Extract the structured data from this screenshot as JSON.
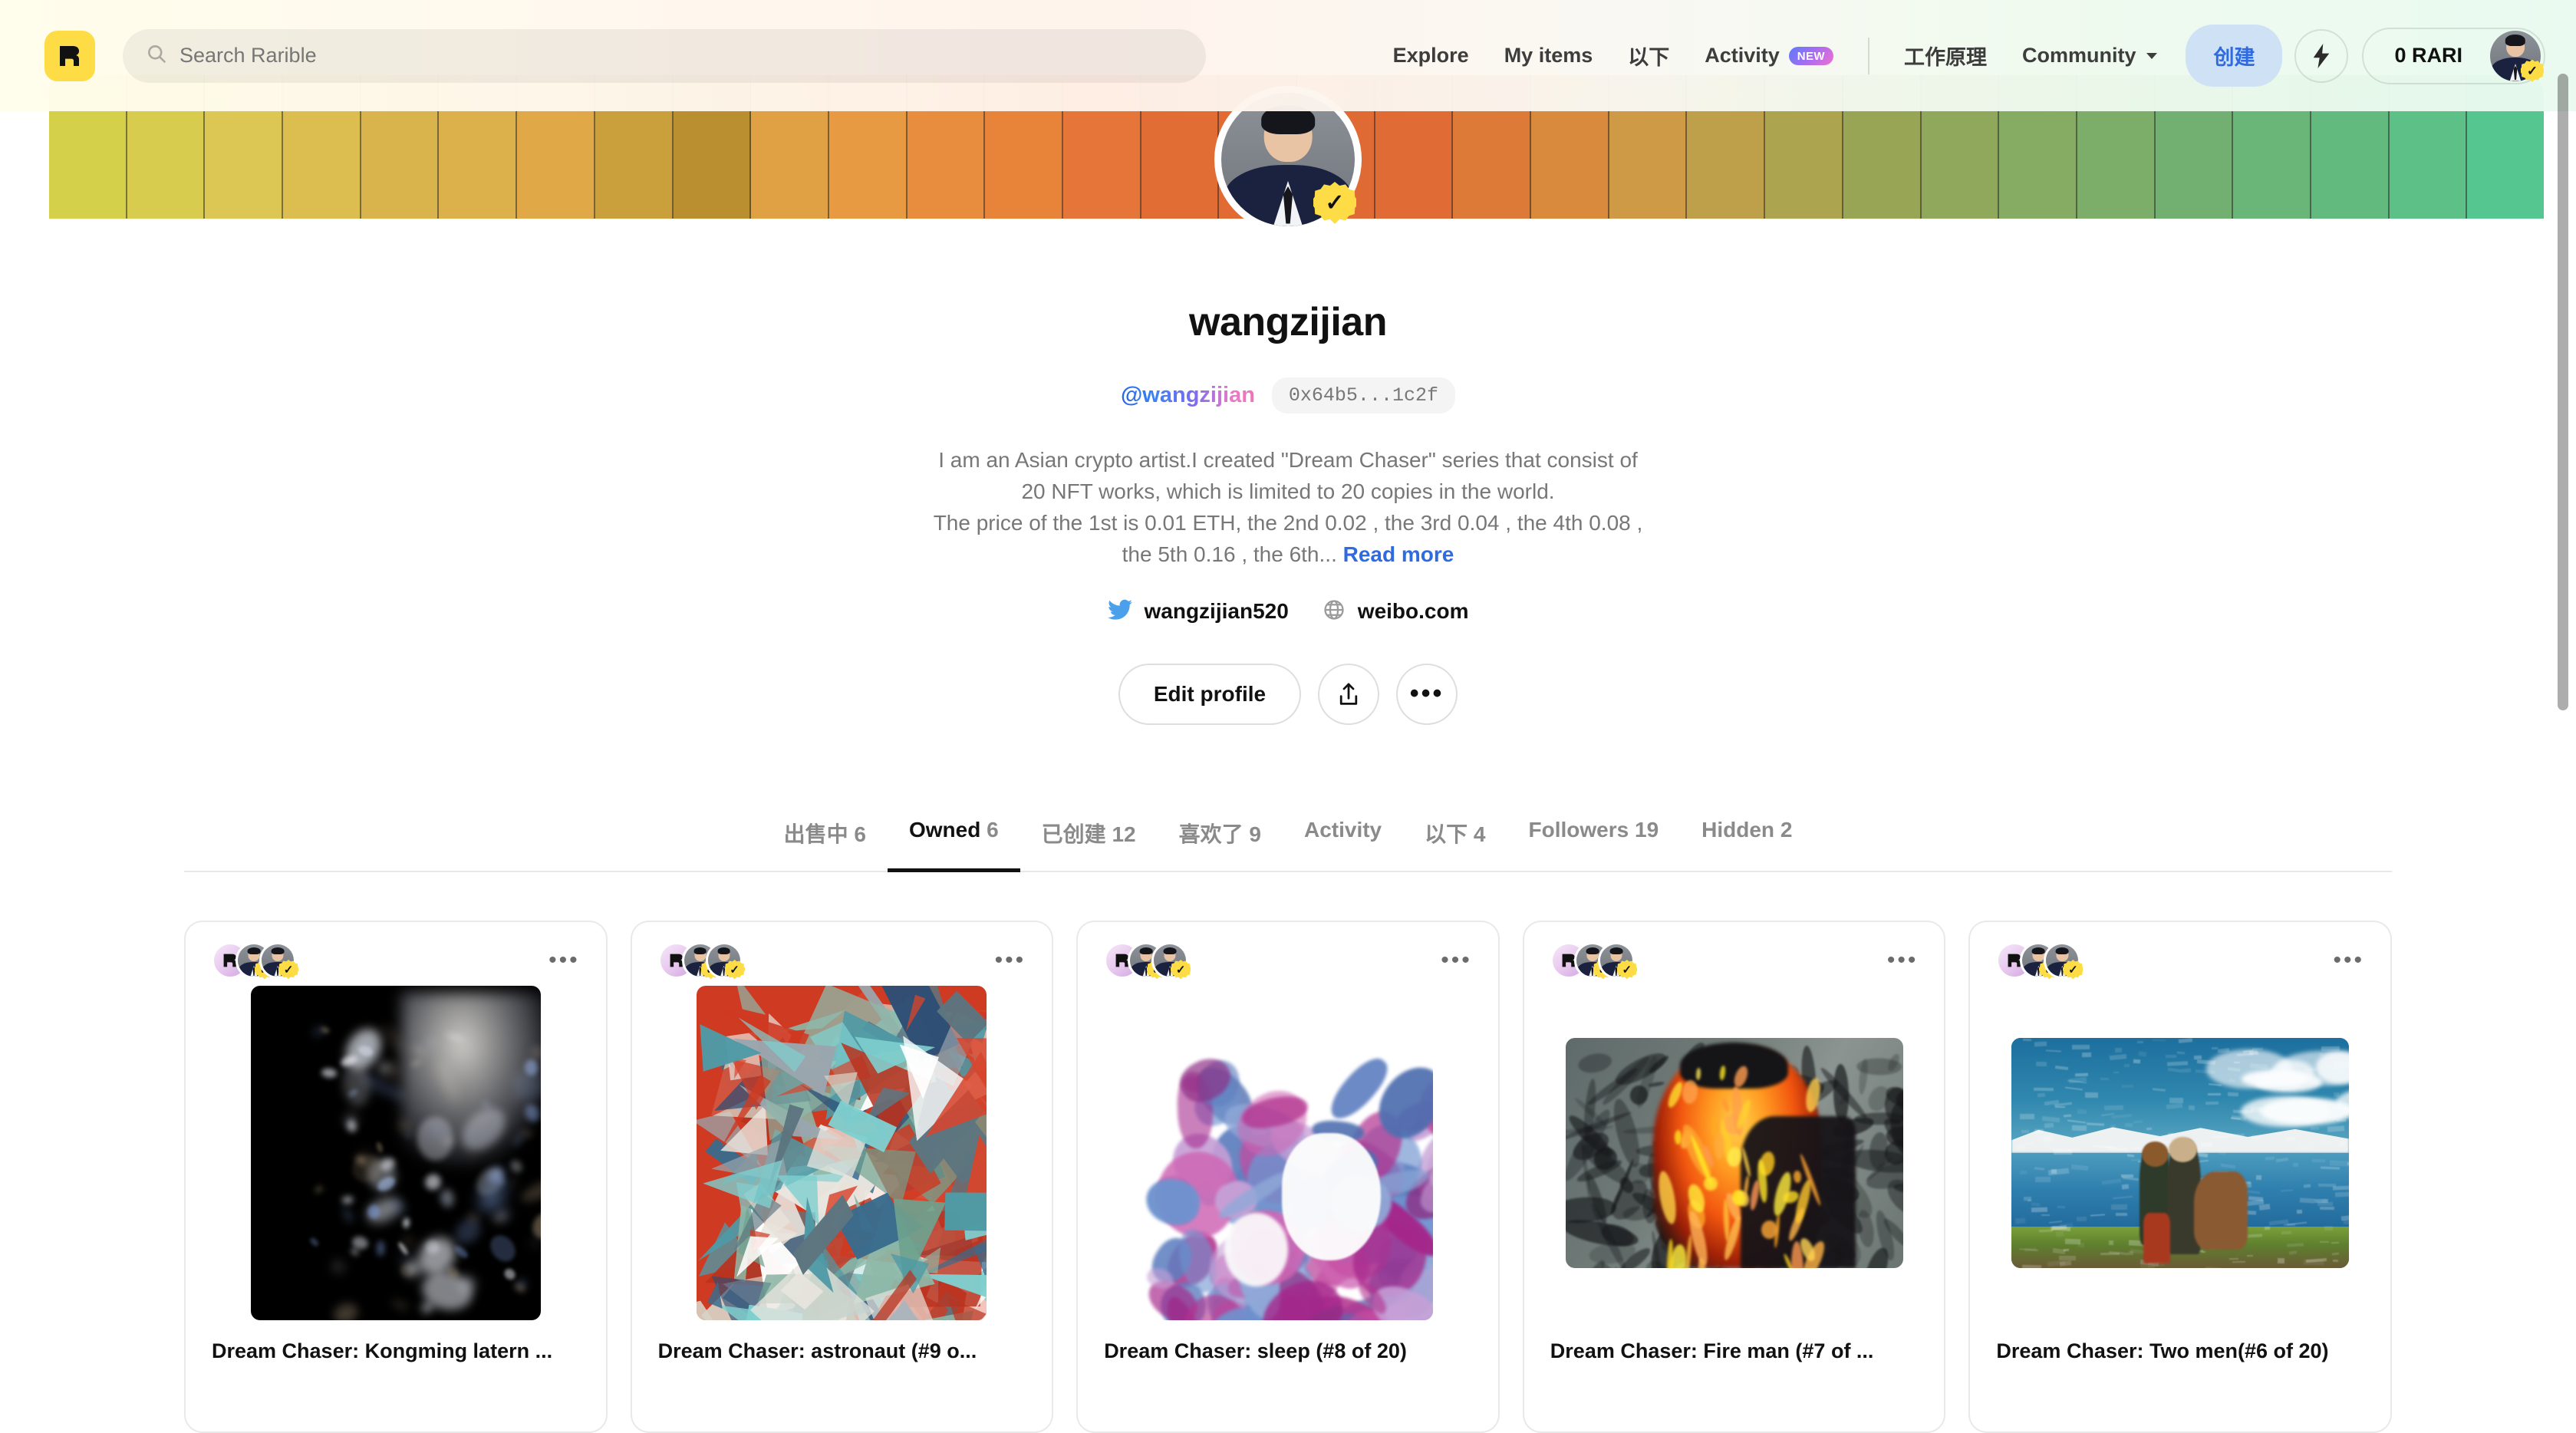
{
  "header": {
    "logo_letter": "R",
    "search": {
      "placeholder": "Search Rarible",
      "value": ""
    },
    "nav": [
      {
        "label": "Explore",
        "badge": null
      },
      {
        "label": "My items",
        "badge": null
      },
      {
        "label": "以下",
        "badge": null
      },
      {
        "label": "Activity",
        "badge": "NEW"
      }
    ],
    "nav_right": [
      {
        "label": "工作原理",
        "chevron": false
      },
      {
        "label": "Community",
        "chevron": true
      }
    ],
    "create_button": "创建",
    "bolt_icon": "lightning-bolt-icon",
    "wallet_balance": "0 RARI"
  },
  "banner": {
    "colors": [
      "#d4d04a",
      "#d8cc4f",
      "#dcc654",
      "#dcbe50",
      "#d9b44c",
      "#dcb14b",
      "#e0a847",
      "#caa03c",
      "#b98f2f",
      "#e0a044",
      "#e79a42",
      "#e88c3d",
      "#e8833a",
      "#e57538",
      "#e26d34",
      "#e26b33",
      "#e06a33",
      "#e06b34",
      "#de7a38",
      "#d98a3c",
      "#cf9a45",
      "#bfa04a",
      "#aca44f",
      "#98a555",
      "#8fa85c",
      "#86ab63",
      "#7cae6a",
      "#72b071",
      "#6ab578",
      "#63ba7f",
      "#5cc087",
      "#55c68f"
    ]
  },
  "profile": {
    "display_name": "wangzijian",
    "handle": "@wangzijian",
    "address": "0x64b5...1c2f",
    "verified": true,
    "bio_line1": "I am an Asian crypto artist.I created \"Dream Chaser\" series that consist of 20 NFT works, which is limited to 20 copies in the world.",
    "bio_line2": "The price of the 1st is 0.01 ETH, the 2nd 0.02 , the 3rd 0.04 , the 4th 0.08 , the 5th 0.16 , the 6th...",
    "read_more": "Read more",
    "socials": [
      {
        "icon": "twitter-icon",
        "label": "wangzijian520"
      },
      {
        "icon": "globe-icon",
        "label": "weibo.com"
      }
    ],
    "edit_button": "Edit profile",
    "share_icon": "share-upload-icon",
    "more_icon": "more-horizontal-icon"
  },
  "tabs": [
    {
      "label": "出售中",
      "count": "6",
      "active": false
    },
    {
      "label": "Owned",
      "count": "6",
      "active": true
    },
    {
      "label": "已创建",
      "count": "12",
      "active": false
    },
    {
      "label": "喜欢了",
      "count": "9",
      "active": false
    },
    {
      "label": "Activity",
      "count": "",
      "active": false
    },
    {
      "label": "以下",
      "count": "4",
      "active": false
    },
    {
      "label": "Followers",
      "count": "19",
      "active": false
    },
    {
      "label": "Hidden",
      "count": "2",
      "active": false
    }
  ],
  "cards": [
    {
      "title": "Dream Chaser: Kongming latern ...",
      "art": "smoke",
      "orientation": "tall"
    },
    {
      "title": "Dream Chaser: astronaut (#9 o...",
      "art": "cubist",
      "orientation": "tall"
    },
    {
      "title": "Dream Chaser: sleep (#8 of 20)",
      "art": "paint",
      "orientation": "tall"
    },
    {
      "title": "Dream Chaser: Fire man (#7 of ...",
      "art": "fire",
      "orientation": "wide"
    },
    {
      "title": "Dream Chaser: Two men(#6 of 20)",
      "art": "lake",
      "orientation": "wide"
    }
  ],
  "colors": {
    "brand_yellow": "#FEDC45",
    "create_blue": "#2f6bdf",
    "create_bg": "#CFE1F5",
    "link_blue": "#2f6bdf",
    "twitter_blue": "#4BA0EB",
    "text_muted": "#8a8a8a"
  }
}
